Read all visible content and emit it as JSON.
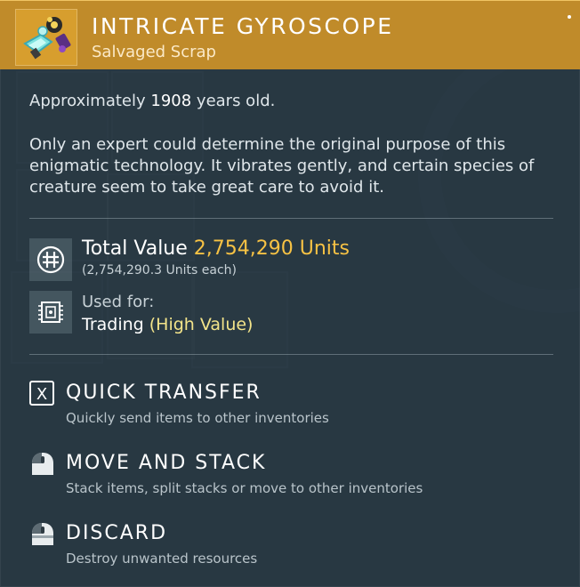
{
  "item": {
    "title": "INTRICATE GYROSCOPE",
    "subtitle": "Salvaged Scrap",
    "icon": "gyroscope-icon",
    "accent_color": "#c08b2a"
  },
  "age": {
    "prefix": "Approximately",
    "value": "1908",
    "suffix": "years old."
  },
  "description": "Only an expert could determine the original purpose of this enigmatic technology. It vibrates gently, and certain species of creature seem to take great care to avoid it.",
  "value": {
    "label": "Total Value",
    "amount": "2,754,290 Units",
    "each": "(2,754,290.3 Units each)",
    "icon": "units-icon",
    "amount_color": "#f7c244"
  },
  "usage": {
    "label": "Used for:",
    "category": "Trading",
    "qualifier": "(High Value)",
    "icon": "trade-chip-icon"
  },
  "actions": [
    {
      "key": "X",
      "label": "QUICK TRANSFER",
      "hint": "Quickly send items to other inventories",
      "icon": "x-key-icon"
    },
    {
      "label": "MOVE AND STACK",
      "hint": "Stack items, split stacks or move to other inventories",
      "icon": "mouse-left-icon"
    },
    {
      "label": "DISCARD",
      "hint": "Destroy unwanted resources",
      "icon": "mouse-hold-icon"
    }
  ]
}
